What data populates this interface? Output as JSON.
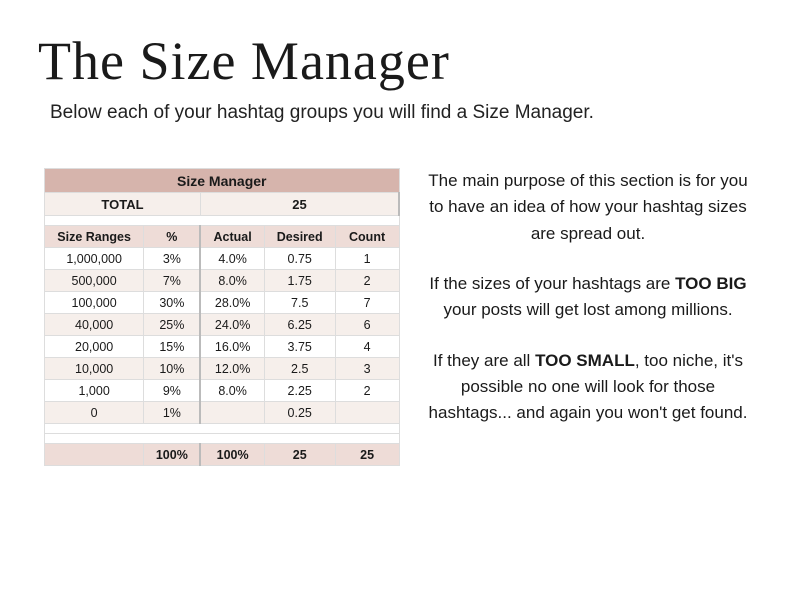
{
  "title": "The Size Manager",
  "subtitle": "Below each of your hashtag groups you will find a Size Manager.",
  "paragraphs": {
    "p1": "The main purpose of this section is for you to have an idea of how your hashtag sizes are spread out.",
    "p2a": "If the sizes of your hashtags are ",
    "p2b": "TOO BIG",
    "p2c": " your posts will get lost among millions.",
    "p3a": "If they are all ",
    "p3b": "TOO SMALL",
    "p3c": ", too niche, it's possible no one will look for those hashtags... and again you won't get found."
  },
  "table": {
    "title": "Size Manager",
    "total_label": "TOTAL",
    "total_value": "25",
    "columns": {
      "c1": "Size Ranges",
      "c2": "%",
      "c3": "Actual",
      "c4": "Desired",
      "c5": "Count"
    },
    "rows": [
      {
        "size": "1,000,000",
        "pct": "3%",
        "actual": "4.0%",
        "desired": "0.75",
        "count": "1"
      },
      {
        "size": "500,000",
        "pct": "7%",
        "actual": "8.0%",
        "desired": "1.75",
        "count": "2"
      },
      {
        "size": "100,000",
        "pct": "30%",
        "actual": "28.0%",
        "desired": "7.5",
        "count": "7"
      },
      {
        "size": "40,000",
        "pct": "25%",
        "actual": "24.0%",
        "desired": "6.25",
        "count": "6"
      },
      {
        "size": "20,000",
        "pct": "15%",
        "actual": "16.0%",
        "desired": "3.75",
        "count": "4"
      },
      {
        "size": "10,000",
        "pct": "10%",
        "actual": "12.0%",
        "desired": "2.5",
        "count": "3"
      },
      {
        "size": "1,000",
        "pct": "9%",
        "actual": "8.0%",
        "desired": "2.25",
        "count": "2"
      },
      {
        "size": "0",
        "pct": "1%",
        "actual": "",
        "desired": "0.25",
        "count": ""
      }
    ],
    "footer": {
      "pct": "100%",
      "actual": "100%",
      "desired": "25",
      "count": "25"
    }
  }
}
